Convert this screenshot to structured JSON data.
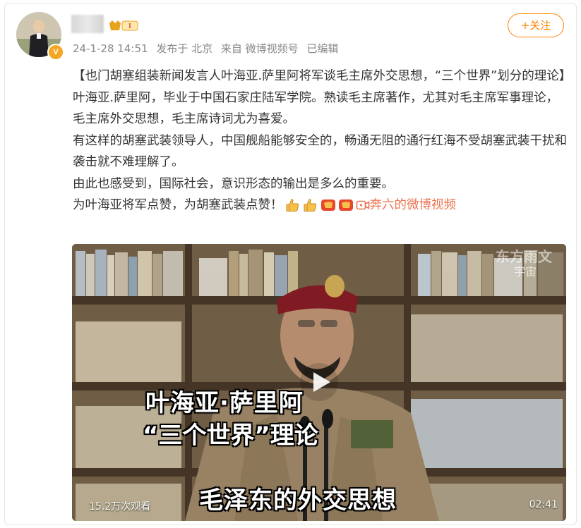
{
  "post": {
    "username_hidden": true,
    "level_badge": "I",
    "verified_badge": "V",
    "meta": {
      "timestamp": "24-1-28 14:51",
      "location": "发布于 北京",
      "source": "来自 微博视频号",
      "edited": "已编辑"
    },
    "follow_label": "+关注",
    "paragraphs": [
      "【也门胡塞组装新闻发言人叶海亚.萨里阿将军谈毛主席外交思想，“三个世界”划分的理论】",
      "叶海亚.萨里阿，毕业于中国石家庄陆军学院。熟读毛主席著作，尤其对毛主席军事理论，毛主席外交思想，毛主席诗词尤为喜爱。",
      "有这样的胡塞武装领导人，中国舰船能够安全的，畅通无阻的通行红海不受胡塞武装干扰和袭击就不难理解了。",
      "由此也感受到，国际社会，意识形态的输出是多么的重要。"
    ],
    "last_line": {
      "text": "为叶海亚将军点赞，为胡塞武装点赞！",
      "emoji_names": [
        "thumbs-up-icon",
        "thumbs-up-icon",
        "fist-icon",
        "fist-icon"
      ],
      "video_link": "奔六的微博视频"
    }
  },
  "video": {
    "views": "15.2万次观看",
    "duration": "02:41",
    "caption_name": "叶海亚·萨里阿",
    "caption_theory": "“三个世界”理论",
    "caption_bottom": "毛泽东的外交思想",
    "watermark_top": "宇宙",
    "watermark_top_faded": "东方雨文"
  },
  "colors": {
    "accent": "#ff8200",
    "link": "#eb7350",
    "meta": "#888888"
  }
}
